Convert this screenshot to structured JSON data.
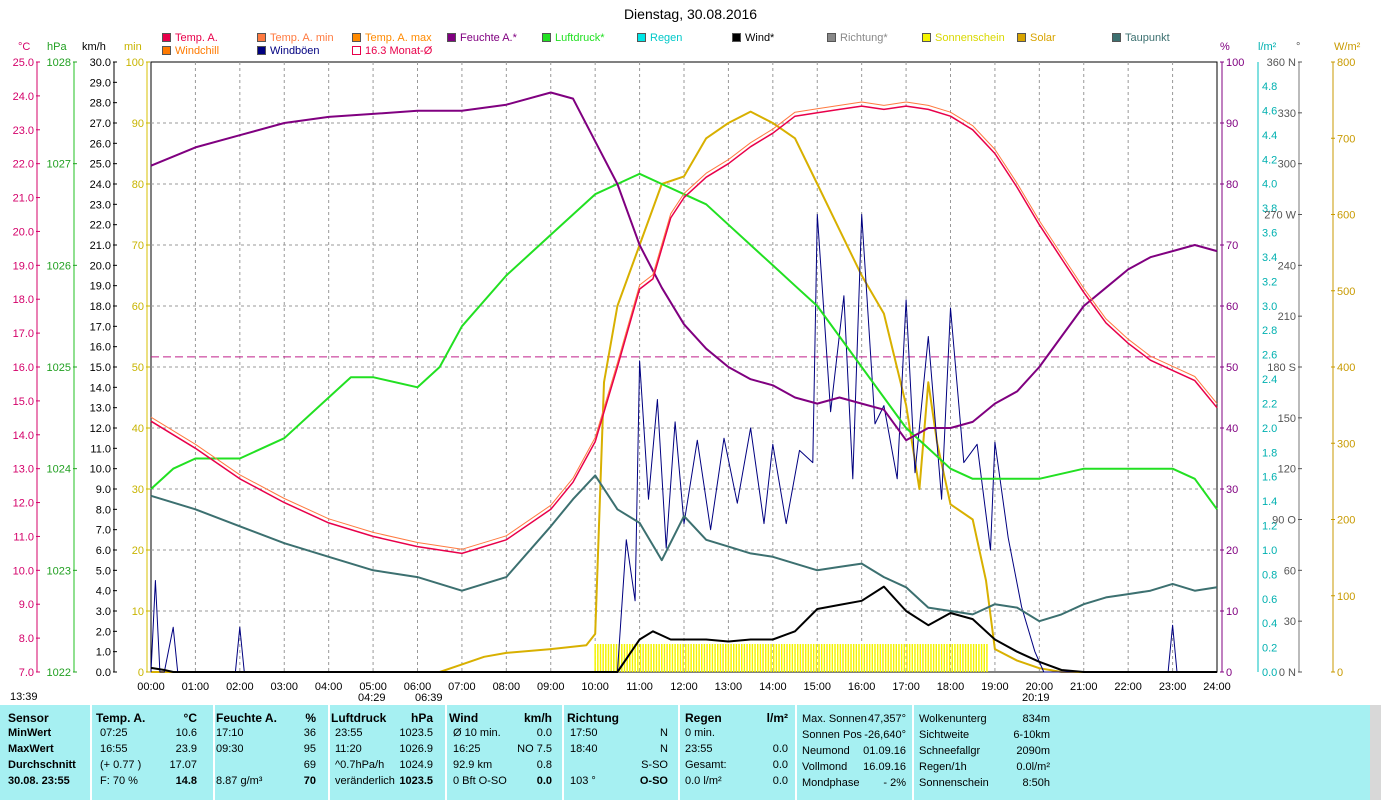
{
  "title": "Dienstag, 30.08.2016",
  "legend": [
    {
      "label": "Temp. A.",
      "color": "#e8004a",
      "hollow": false
    },
    {
      "label": "Temp. A. min",
      "color": "#ff7a40",
      "hollow": false
    },
    {
      "label": "Temp. A. max",
      "color": "#ff8a00",
      "hollow": false
    },
    {
      "label": "Feuchte A.*",
      "color": "#800080",
      "hollow": false
    },
    {
      "label": "Luftdruck*",
      "color": "#22e022",
      "hollow": false
    },
    {
      "label": "Regen",
      "color": "#00e6e6",
      "hollow": false
    },
    {
      "label": "Wind*",
      "color": "#000000",
      "hollow": false
    },
    {
      "label": "Richtung*",
      "color": "#888888",
      "hollow": false
    },
    {
      "label": "Sonnenschein",
      "color": "#f4f400",
      "hollow": false
    },
    {
      "label": "Solar",
      "color": "#d8a400",
      "hollow": false
    },
    {
      "label": "Taupunkt",
      "color": "#3c7070",
      "hollow": false
    },
    {
      "label": "Windchill",
      "color": "#ff7a00",
      "hollow": false
    },
    {
      "label": "Windböen",
      "color": "#000080",
      "hollow": false
    },
    {
      "label": "16.3 Monat-Ø",
      "color": "#e8004a",
      "hollow": true
    }
  ],
  "unit_labels": {
    "celsius": "°C",
    "hpa": "hPa",
    "kmh": "km/h",
    "min": "min",
    "percent": "%",
    "lm2": "l/m²",
    "deg": "°",
    "wm2": "W/m²"
  },
  "axis_ticks": {
    "temp_c": [
      "25.0",
      "24.0",
      "23.0",
      "22.0",
      "21.0",
      "20.0",
      "19.0",
      "18.0",
      "17.0",
      "16.0",
      "15.0",
      "14.0",
      "13.0",
      "12.0",
      "11.0",
      "10.0",
      "9.0",
      "8.0",
      "7.0"
    ],
    "pressure_hpa": [
      "1028",
      "1027",
      "1026",
      "1025",
      "1024",
      "1023",
      "1022"
    ],
    "wind_kmh": [
      "30.0",
      "29.0",
      "28.0",
      "27.0",
      "26.0",
      "25.0",
      "24.0",
      "23.0",
      "22.0",
      "21.0",
      "20.0",
      "19.0",
      "18.0",
      "17.0",
      "16.0",
      "15.0",
      "14.0",
      "13.0",
      "12.0",
      "11.0",
      "10.0",
      "9.0",
      "8.0",
      "7.0",
      "6.0",
      "5.0",
      "4.0",
      "3.0",
      "2.0",
      "1.0",
      "0.0"
    ],
    "sun_min": [
      "100",
      "90",
      "80",
      "70",
      "60",
      "50",
      "40",
      "30",
      "20",
      "10",
      "0"
    ],
    "hum_pct": [
      "100",
      "90",
      "80",
      "70",
      "60",
      "50",
      "40",
      "30",
      "20",
      "10",
      "0"
    ],
    "rain_lm2": [
      "4.8",
      "4.6",
      "4.4",
      "4.2",
      "4.0",
      "3.8",
      "3.6",
      "3.4",
      "3.2",
      "3.0",
      "2.8",
      "2.6",
      "2.4",
      "2.2",
      "2.0",
      "1.8",
      "1.6",
      "1.4",
      "1.2",
      "1.0",
      "0.8",
      "0.6",
      "0.4",
      "0.2",
      "0.0"
    ],
    "dir_deg": [
      "360 N",
      "330",
      "300",
      "270 W",
      "240",
      "210",
      "180 S",
      "150",
      "120",
      "90 O",
      "60",
      "30",
      "0 N"
    ],
    "solar_wm2": [
      "800",
      "700",
      "600",
      "500",
      "400",
      "300",
      "200",
      "100",
      "0"
    ],
    "time": [
      "00:00",
      "01:00",
      "02:00",
      "03:00",
      "04:00",
      "05:00",
      "06:00",
      "07:00",
      "08:00",
      "09:00",
      "10:00",
      "11:00",
      "12:00",
      "13:00",
      "14:00",
      "15:00",
      "16:00",
      "17:00",
      "18:00",
      "19:00",
      "20:00",
      "21:00",
      "22:00",
      "23:00",
      "24:00"
    ]
  },
  "time_markers": {
    "left": "13:39",
    "sunrise": "04:29",
    "dawn": "06:39",
    "sunset": "20:19"
  },
  "chart_data": {
    "type": "line",
    "title": "Dienstag, 30.08.2016",
    "xlim": [
      0,
      24
    ],
    "month_avg_temp": 16.3,
    "series": [
      {
        "name": "Temp. A.",
        "unit": "°C",
        "ylim": [
          7,
          25
        ],
        "x": [
          0,
          1,
          2,
          3,
          4,
          5,
          6,
          7,
          8,
          9,
          9.5,
          10,
          10.5,
          11,
          11.3,
          11.7,
          12,
          12.5,
          13,
          13.5,
          14,
          14.5,
          15,
          15.5,
          16,
          16.5,
          17,
          17.5,
          18,
          18.5,
          19,
          19.5,
          20,
          20.5,
          21,
          21.5,
          22,
          22.5,
          23,
          23.5,
          24
        ],
        "y": [
          14.4,
          13.6,
          12.7,
          12.0,
          11.4,
          11.0,
          10.7,
          10.5,
          10.9,
          11.8,
          12.6,
          13.8,
          16.0,
          18.3,
          18.6,
          20.4,
          21.0,
          21.6,
          22.0,
          22.5,
          22.9,
          23.4,
          23.5,
          23.6,
          23.7,
          23.6,
          23.7,
          23.6,
          23.4,
          23.0,
          22.3,
          21.3,
          20.2,
          19.2,
          18.2,
          17.3,
          16.7,
          16.2,
          15.9,
          15.6,
          14.8
        ]
      },
      {
        "name": "Feuchte A.*",
        "unit": "%",
        "ylim": [
          0,
          100
        ],
        "x": [
          0,
          1,
          2,
          3,
          4,
          5,
          6,
          7,
          8,
          9,
          9.5,
          10,
          10.5,
          11,
          11.5,
          12,
          12.5,
          13,
          13.5,
          14,
          14.5,
          15,
          15.5,
          16,
          16.5,
          17,
          17.5,
          18,
          18.5,
          19,
          19.5,
          20,
          20.5,
          21,
          21.5,
          22,
          22.5,
          23,
          23.5,
          24
        ],
        "y": [
          83,
          86,
          88,
          90,
          91,
          91.5,
          92,
          92,
          93,
          95,
          94,
          87,
          80,
          70,
          63,
          57,
          53,
          50,
          48,
          47,
          45,
          44,
          45,
          44,
          43,
          38,
          40,
          40,
          41,
          44,
          46,
          50,
          55,
          60,
          63,
          66,
          68,
          69,
          70,
          69
        ]
      },
      {
        "name": "Luftdruck*",
        "unit": "hPa",
        "ylim": [
          1022,
          1028
        ],
        "x": [
          0,
          0.5,
          1,
          2,
          3,
          4,
          4.5,
          5,
          6,
          6.5,
          7,
          8,
          9,
          9.5,
          10,
          10.5,
          11,
          11.5,
          12,
          12.5,
          13,
          13.5,
          14,
          14.5,
          15,
          15.5,
          16,
          16.5,
          17,
          17.5,
          18,
          18.5,
          19,
          19.5,
          20,
          21,
          22,
          23,
          23.5,
          24
        ],
        "y": [
          1023.8,
          1024.0,
          1024.1,
          1024.1,
          1024.3,
          1024.7,
          1024.9,
          1024.9,
          1024.8,
          1025.0,
          1025.4,
          1025.9,
          1026.3,
          1026.5,
          1026.7,
          1026.8,
          1026.9,
          1026.8,
          1026.7,
          1026.6,
          1026.4,
          1026.2,
          1026.0,
          1025.8,
          1025.6,
          1025.3,
          1025.0,
          1024.7,
          1024.4,
          1024.2,
          1024.0,
          1023.9,
          1023.9,
          1023.9,
          1023.9,
          1024.0,
          1024.0,
          1024.0,
          1023.9,
          1023.6
        ]
      },
      {
        "name": "Taupunkt",
        "unit": "°C",
        "ylim": [
          7,
          25
        ],
        "x": [
          0,
          1,
          2,
          3,
          4,
          5,
          6,
          7,
          8,
          9,
          9.5,
          10,
          10.5,
          11,
          11.5,
          12,
          12.5,
          13,
          13.5,
          14,
          14.5,
          15,
          15.5,
          16,
          16.5,
          17,
          17.5,
          18,
          18.5,
          19,
          19.5,
          20,
          20.5,
          21,
          21.5,
          22,
          22.5,
          23,
          23.5,
          24
        ],
        "y": [
          12.2,
          11.8,
          11.3,
          10.8,
          10.4,
          10.0,
          9.8,
          9.4,
          9.8,
          11.3,
          12.1,
          12.8,
          11.8,
          11.4,
          10.3,
          11.6,
          10.9,
          10.7,
          10.5,
          10.4,
          10.2,
          10.0,
          10.1,
          10.2,
          9.8,
          9.5,
          8.9,
          8.8,
          8.7,
          9.0,
          8.9,
          8.5,
          8.7,
          9.0,
          9.2,
          9.3,
          9.4,
          9.6,
          9.4,
          9.5
        ]
      },
      {
        "name": "Solar",
        "unit": "W/m²",
        "ylim": [
          0,
          800
        ],
        "x": [
          0,
          6.5,
          7,
          7.5,
          8,
          9,
          9.8,
          10,
          10.2,
          10.5,
          11,
          11.5,
          12,
          12.5,
          13,
          13.5,
          14,
          14.5,
          15,
          15.5,
          16,
          16.5,
          17,
          17.3,
          17.5,
          17.7,
          18,
          18.5,
          18.8,
          19,
          19.5,
          20,
          20.5,
          24
        ],
        "y": [
          0,
          0,
          10,
          20,
          25,
          30,
          35,
          50,
          380,
          480,
          560,
          640,
          650,
          700,
          720,
          735,
          720,
          700,
          640,
          580,
          520,
          470,
          350,
          240,
          380,
          300,
          220,
          200,
          120,
          30,
          15,
          5,
          0,
          0
        ]
      },
      {
        "name": "Wind*",
        "unit": "km/h",
        "ylim": [
          0,
          30
        ],
        "x": [
          0,
          0.3,
          0.5,
          1,
          10.5,
          11,
          11.3,
          11.7,
          12,
          12.5,
          13,
          13.5,
          14,
          14.5,
          15,
          15.5,
          16,
          16.5,
          17,
          17.5,
          18,
          18.5,
          19,
          19.5,
          20,
          20.5,
          21,
          24
        ],
        "y": [
          0.2,
          0.1,
          0,
          0,
          0,
          1.6,
          2.0,
          1.6,
          1.6,
          1.6,
          1.5,
          1.6,
          1.6,
          2.0,
          3.1,
          3.3,
          3.5,
          4.2,
          3.0,
          2.3,
          2.9,
          2.6,
          1.6,
          1.0,
          0.5,
          0.1,
          0,
          0
        ]
      },
      {
        "name": "Windböen",
        "unit": "km/h",
        "ylim": [
          0,
          30
        ],
        "x": [
          0,
          0.1,
          0.2,
          0.3,
          0.5,
          0.6,
          0.7,
          1.9,
          2,
          2.1,
          10.5,
          10.7,
          10.9,
          11,
          11.2,
          11.4,
          11.6,
          11.8,
          12,
          12.3,
          12.6,
          12.9,
          13.2,
          13.5,
          13.8,
          14,
          14.3,
          14.6,
          14.9,
          15,
          15.3,
          15.6,
          15.8,
          16,
          16.3,
          16.5,
          16.8,
          17,
          17.2,
          17.5,
          17.8,
          18,
          18.3,
          18.6,
          18.9,
          19,
          19.3,
          19.6,
          19.9,
          20.1,
          22.9,
          23,
          23.1,
          23.2,
          23.3,
          24
        ],
        "y": [
          0,
          4.5,
          0,
          0,
          2.2,
          0,
          0,
          0,
          2.2,
          0,
          0,
          6.5,
          3.5,
          15.3,
          8.5,
          13.4,
          6.1,
          12.3,
          7.3,
          11.4,
          7.0,
          11.5,
          8.3,
          12.0,
          7.3,
          11.2,
          7.3,
          10.9,
          10.3,
          22.5,
          12.8,
          18.5,
          9.5,
          22.5,
          12.2,
          13.1,
          9.5,
          18.3,
          9.8,
          16.5,
          8.5,
          17.9,
          10.3,
          11.2,
          6.0,
          11.3,
          6.6,
          3.2,
          1.0,
          0,
          0,
          2.3,
          0,
          0,
          0,
          0
        ]
      }
    ]
  },
  "stats": {
    "headers": {
      "sensor": "Sensor",
      "temp": "Temp. A.",
      "temp_unit": "°C",
      "feuchte": "Feuchte A.",
      "feuchte_unit": "%",
      "luftdruck": "Luftdruck",
      "luftdruck_unit": "hPa",
      "wind": "Wind",
      "wind_unit": "km/h",
      "richtung": "Richtung",
      "regen": "Regen",
      "regen_unit": "l/m²"
    },
    "rows": [
      {
        "label": "MinWert",
        "t_time": "07:25",
        "t_val": "10.6",
        "f_time": "17:10",
        "f_val": "36",
        "p_time": "23:55",
        "p_val": "1023.5",
        "w_a": "Ø 10 min.",
        "w_b": "0.0",
        "r_time": "17:50",
        "r_dir": "N",
        "rg_a": "0 min.",
        "rg_b": ""
      },
      {
        "label": "MaxWert",
        "t_time": "16:55",
        "t_val": "23.9",
        "f_time": "09:30",
        "f_val": "95",
        "p_time": "11:20",
        "p_val": "1026.9",
        "w_a": "16:25",
        "w_b": "NO 7.5",
        "r_time": "18:40",
        "r_dir": "N",
        "rg_a": "23:55",
        "rg_b": "0.0"
      },
      {
        "label": "Durchschnitt",
        "t_time": "(+ 0.77 )",
        "t_val": "17.07",
        "f_time": "",
        "f_val": "69",
        "p_time": "^0.7hPa/h",
        "p_val": "1024.9",
        "w_a": "92.9 km",
        "w_b": "0.8",
        "r_time": "",
        "r_dir": "S-SO",
        "rg_a": "Gesamt:",
        "rg_b": "0.0"
      },
      {
        "label": "30.08. 23:55",
        "t_time": "F: 70 %",
        "t_val": "14.8",
        "f_time": "8.87 g/m³",
        "f_val": "70",
        "p_time": "veränderlich",
        "p_val": "1023.5",
        "w_a": "0 Bft O-SO",
        "w_b": "0.0",
        "r_time": "103 °",
        "r_dir": "O-SO",
        "rg_a": "0.0 l/m²",
        "rg_b": "0.0"
      }
    ],
    "astro": [
      {
        "k": "Max. Sonnen",
        "v": "47,357°"
      },
      {
        "k": "Sonnen Pos",
        "v": "-26,640°"
      },
      {
        "k": "Neumond",
        "v": "01.09.16"
      },
      {
        "k": "Vollmond",
        "v": "16.09.16"
      },
      {
        "k": "Mondphase",
        "v": "- 2%"
      }
    ],
    "weather": [
      {
        "k": "Wolkenunterg",
        "v": "834m"
      },
      {
        "k": "Sichtweite",
        "v": "6-10km"
      },
      {
        "k": "Schneefallgr",
        "v": "2090m"
      },
      {
        "k": "Regen/1h",
        "v": "0.0l/m²"
      },
      {
        "k": "Sonnenschein",
        "v": "8:50h"
      }
    ]
  }
}
